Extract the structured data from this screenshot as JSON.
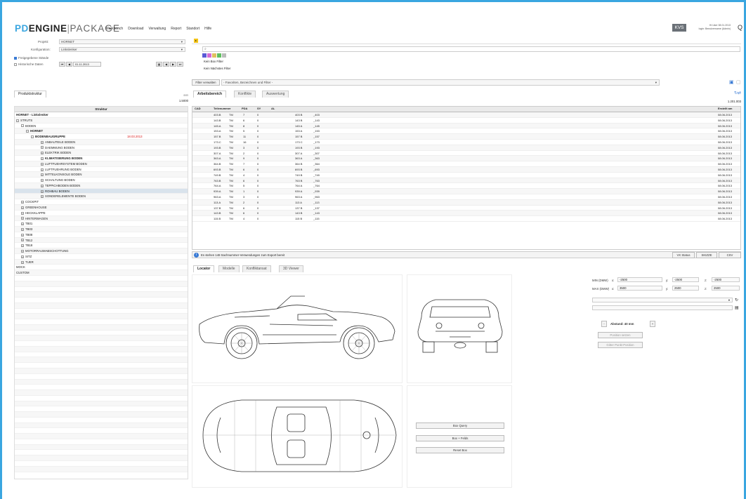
{
  "app": {
    "logo_pd": "PD",
    "logo_engine": "ENGINE",
    "logo_sep": "|",
    "logo_package": "PACKAGE",
    "menu": [
      "Workbench",
      "Download",
      "Verwaltung",
      "Report",
      "Standort",
      "Hilfe"
    ],
    "kvs": "KVS",
    "user_line1": "Hi User 08.01.2013",
    "user_line2": "login: Benutzername (Admin)",
    "quick_icon": "Q"
  },
  "left": {
    "project_label": "Projekt:",
    "project_value": "HORNET",
    "config_label": "Konfiguration:",
    "config_value": "Linkslenker",
    "released_label": "Freigegebene Stände",
    "historic_label": "Historische Daten",
    "historic_date": "01.11.2013",
    "tab_product": "Produktstruktur",
    "tree_count": "1.5000",
    "tree_header": "Struktur",
    "tree": [
      {
        "label": "HORNET - Linkslenker",
        "level": 0,
        "bold": true,
        "exp": ""
      },
      {
        "label": "STRUTS",
        "level": 0,
        "exp": "-"
      },
      {
        "label": "BODEN",
        "level": 1,
        "exp": "-"
      },
      {
        "label": "HORNET",
        "level": 2,
        "exp": "-",
        "bold": true
      },
      {
        "label": "BODENBAUGRUPPE",
        "level": 3,
        "exp": "-",
        "bold": true,
        "date": "18.03.2013"
      },
      {
        "label": "ANBAUTEILE BODEN",
        "level": 5,
        "exp": "+"
      },
      {
        "label": "DAEMMUNG BODEN",
        "level": 5,
        "exp": "+"
      },
      {
        "label": "ELEKTRIK BODEN",
        "level": 5,
        "exp": "+"
      },
      {
        "label": "KLIMATISIERUNG BODEN",
        "level": 5,
        "exp": "+",
        "bold": true
      },
      {
        "label": "LUFTFUEHRSYSTEM BODEN",
        "level": 5,
        "exp": "+"
      },
      {
        "label": "LUFTFUEHRUNG BODEN",
        "level": 5,
        "exp": "+"
      },
      {
        "label": "MITTELKONSOLE BODEN",
        "level": 5,
        "exp": "+"
      },
      {
        "label": "SCHALTUNG BODEN",
        "level": 5,
        "exp": "+"
      },
      {
        "label": "TEPPICHBODEN BODEN",
        "level": 5,
        "exp": "+"
      },
      {
        "label": "ROHBAU BODEN",
        "level": 5,
        "exp": "+",
        "sel": true
      },
      {
        "label": "SONDERELEMENTE BODEN",
        "level": 5,
        "exp": "+"
      },
      {
        "label": "COCKPIT",
        "level": 1,
        "exp": "+"
      },
      {
        "label": "GREENHOUSE",
        "level": 1,
        "exp": "+"
      },
      {
        "label": "HECKKLAPPE",
        "level": 1,
        "exp": "+"
      },
      {
        "label": "HINTERWAGEN",
        "level": 1,
        "exp": "+"
      },
      {
        "label": "TB01",
        "level": 1,
        "exp": "+"
      },
      {
        "label": "TB03",
        "level": 1,
        "exp": "+"
      },
      {
        "label": "TB08",
        "level": 1,
        "exp": "+"
      },
      {
        "label": "TB12",
        "level": 1,
        "exp": "+"
      },
      {
        "label": "TB18",
        "level": 1,
        "exp": "+"
      },
      {
        "label": "MOTORRAUMABSCHOTTUNG",
        "level": 1,
        "exp": "+"
      },
      {
        "label": "SITZ",
        "level": 1,
        "exp": "+"
      },
      {
        "label": "TUER",
        "level": 1,
        "exp": "+"
      },
      {
        "label": "MOCK",
        "level": 0,
        "exp": ""
      },
      {
        "label": "CUSTOM",
        "level": 0,
        "exp": ""
      }
    ]
  },
  "right": {
    "filter_none": "Kein Box Filter",
    "filter_nearest": "Kein Nächstes Filter",
    "filter_button": "Filter verwalten",
    "filter_select": "- Favoriten, Bezeichnen und Filter -",
    "tabs": [
      "Arbeitsbereich",
      "Konflikte",
      "Auswertung"
    ],
    "grid_count": "1.201.003",
    "columns": [
      "CAD",
      "Teilenummer",
      "PDA",
      "SY",
      "AL",
      "Erstellt am"
    ],
    "rows": [
      [
        "403.B",
        "TM",
        "7",
        "0",
        "403 B",
        "_403",
        "08.06.2013"
      ],
      [
        "143.B",
        "TM",
        "6",
        "0",
        "143 B",
        "_143",
        "08.06.2013"
      ],
      [
        "145.A",
        "TM",
        "8",
        "0",
        "145 A",
        "_145",
        "08.06.2013"
      ],
      [
        "153.A",
        "TM",
        "5",
        "0",
        "153 A",
        "_153",
        "08.06.2013"
      ],
      [
        "157.B",
        "TM",
        "11",
        "0",
        "157 B",
        "_157",
        "08.06.2013"
      ],
      [
        "173.C",
        "TM",
        "16",
        "0",
        "173 C",
        "_173",
        "08.06.2013"
      ],
      [
        "193.B",
        "TM",
        "3",
        "0",
        "193 B",
        "_193",
        "08.06.2013"
      ],
      [
        "307.A",
        "TM",
        "2",
        "0",
        "307 A",
        "_307",
        "08.06.2013"
      ],
      [
        "363.A",
        "TM",
        "9",
        "0",
        "363 A",
        "_363",
        "08.06.2013"
      ],
      [
        "364.B",
        "TM",
        "7",
        "0",
        "364 B",
        "_364",
        "08.06.2013"
      ],
      [
        "693.B",
        "TM",
        "6",
        "0",
        "693 B",
        "_693",
        "08.06.2013"
      ],
      [
        "749.B",
        "TM",
        "4",
        "0",
        "749 B",
        "_749",
        "08.06.2013"
      ],
      [
        "763.B",
        "TM",
        "6",
        "0",
        "763 B",
        "_763",
        "08.06.2013"
      ],
      [
        "764.A",
        "TM",
        "5",
        "0",
        "764 A",
        "_764",
        "08.06.2013"
      ],
      [
        "939.A",
        "TM",
        "1",
        "0",
        "939 A",
        "_939",
        "08.06.2013"
      ],
      [
        "963.A",
        "TM",
        "3",
        "0",
        "963 A",
        "_963",
        "08.06.2013"
      ],
      [
        "113.A",
        "TM",
        "2",
        "0",
        "113 A",
        "_113",
        "08.06.2013"
      ],
      [
        "137.B",
        "TM",
        "6",
        "0",
        "137 B",
        "_137",
        "08.06.2013"
      ],
      [
        "143.B",
        "TM",
        "6",
        "0",
        "143 B",
        "_143",
        "08.06.2013"
      ],
      [
        "115.B",
        "TM",
        "4",
        "0",
        "115 B",
        "_115",
        "08.06.2013"
      ]
    ],
    "status": "Es stehen 148 Sachnummer-Verwendungen zum Export bereit",
    "btn_vx": "VX Status",
    "btn_skizze": "SKIZZE",
    "btn_csv": "CSV",
    "bottom_tabs": [
      "Locator",
      "Modelle",
      "Konfliktansat",
      "3D Viewer"
    ],
    "min_label": "MIN (DMW)",
    "max_label": "MAX (DMW)",
    "min_x": "-2500",
    "min_y": "-2500",
    "min_z": "-2500",
    "max_x": "3500",
    "max_y": "2500",
    "max_z": "2500",
    "x": "x:",
    "y": "y:",
    "z": "z:",
    "abstand_label": "Abstand: 40 mm",
    "btn_position": "Position setzen",
    "btn_punkt": "Gitter Punkt Position",
    "btn_query": "Box Query",
    "btn_box_fields": "Box + Felds",
    "btn_reset": "Reset Box"
  }
}
